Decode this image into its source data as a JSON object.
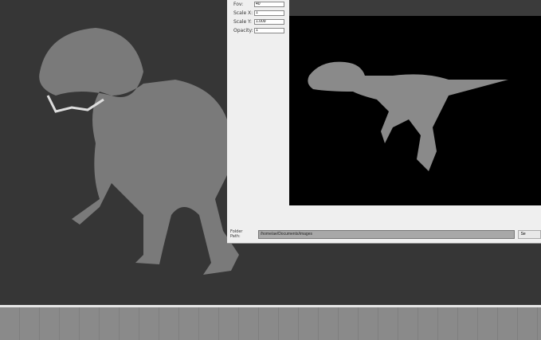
{
  "properties": [
    {
      "label": "Fov:",
      "value": "40"
    },
    {
      "label": "Scale X:",
      "value": "1"
    },
    {
      "label": "Scale Y:",
      "value": "1.009"
    },
    {
      "label": "Opacity:",
      "value": "1"
    }
  ],
  "folder": {
    "label": "Folder Path:",
    "value": "/home/ae/Documents/images",
    "button": "Se"
  },
  "colors": {
    "viewport": "#363636",
    "dialog": "#efefef",
    "preview": "#000000"
  }
}
